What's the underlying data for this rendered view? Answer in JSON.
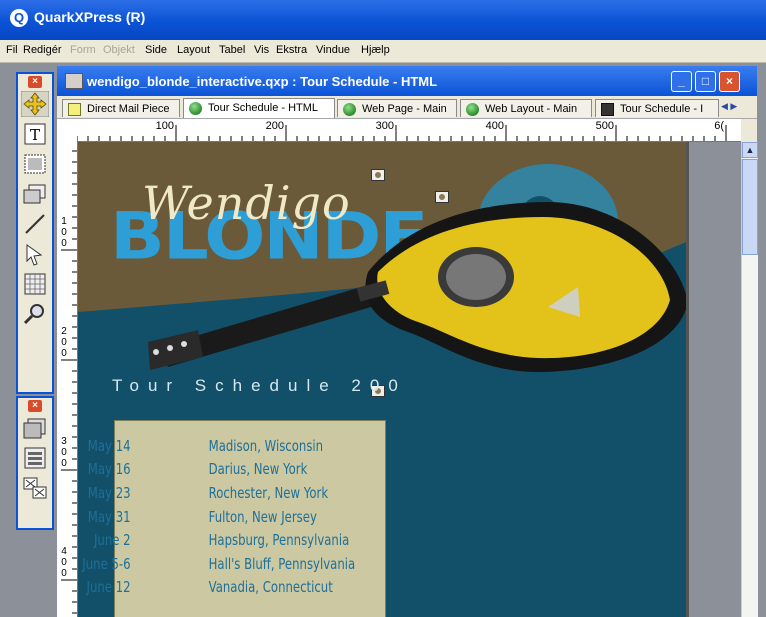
{
  "app": {
    "title": "QuarkXPress (R)"
  },
  "menu": {
    "items": [
      {
        "label": "Fil",
        "enabled": true
      },
      {
        "label": "Redigér",
        "enabled": true
      },
      {
        "label": "Form",
        "enabled": false
      },
      {
        "label": "Objekt",
        "enabled": false
      },
      {
        "label": "Side",
        "enabled": true
      },
      {
        "label": "Layout",
        "enabled": true
      },
      {
        "label": "Tabel",
        "enabled": true
      },
      {
        "label": "Vis",
        "enabled": true
      },
      {
        "label": "Ekstra",
        "enabled": true
      },
      {
        "label": "Vindue",
        "enabled": true
      },
      {
        "label": "Hjælp",
        "enabled": true
      }
    ]
  },
  "tools": {
    "palette1": [
      "move-tool-icon",
      "text-tool-icon",
      "picture-box-tool-icon",
      "box-tool-icon",
      "line-tool-icon",
      "bezier-tool-icon",
      "table-tool-icon",
      "zoom-tool-icon"
    ],
    "palette2": [
      "rollover-tool-icon",
      "form-tool-icon",
      "image-map-tool-icon"
    ]
  },
  "document": {
    "title": "wendigo_blonde_interactive.qxp : Tour Schedule - HTML",
    "tabs": [
      {
        "label": "Direct Mail Piece",
        "icon": "print-layout-icon",
        "active": false
      },
      {
        "label": "Tour Schedule - HTML",
        "icon": "web-layout-icon",
        "active": true
      },
      {
        "label": "Web Page - Main",
        "icon": "web-layout-icon",
        "active": false
      },
      {
        "label": "Web Layout - Main",
        "icon": "web-layout-icon",
        "active": false
      },
      {
        "label": "Tour Schedule - I",
        "icon": "interactive-layout-icon",
        "active": false
      }
    ],
    "ruler": {
      "h_labels": [
        "100",
        "200",
        "300",
        "400",
        "500",
        "6("
      ],
      "v_labels": [
        [
          "1",
          "0",
          "0"
        ],
        [
          "2",
          "0",
          "0"
        ],
        [
          "3",
          "0",
          "0"
        ],
        [
          "4",
          "0",
          "0"
        ]
      ]
    },
    "colors": {
      "page_bg": "#12506a",
      "brand_blue": "#2e9fd6",
      "box_bg": "#ccc9a2",
      "text_blue": "#1f6f98"
    }
  },
  "page": {
    "brand_script": "Wendigo",
    "brand_block": "BLONDE",
    "tour_heading": "Tour Schedule 200",
    "schedule": [
      {
        "date": "May 14",
        "city": "Madison, Wisconsin"
      },
      {
        "date": "May 16",
        "city": "Darius, New York"
      },
      {
        "date": "May 23",
        "city": "Rochester, New York"
      },
      {
        "date": "May 31",
        "city": "Fulton, New Jersey"
      },
      {
        "date": "June 2",
        "city": "Hapsburg, Pennsylvania"
      },
      {
        "date": "June 5-6",
        "city": "Hall's Bluff, Pennsylvania"
      },
      {
        "date": "June 12",
        "city": "Vanadia, Connecticut"
      }
    ]
  }
}
